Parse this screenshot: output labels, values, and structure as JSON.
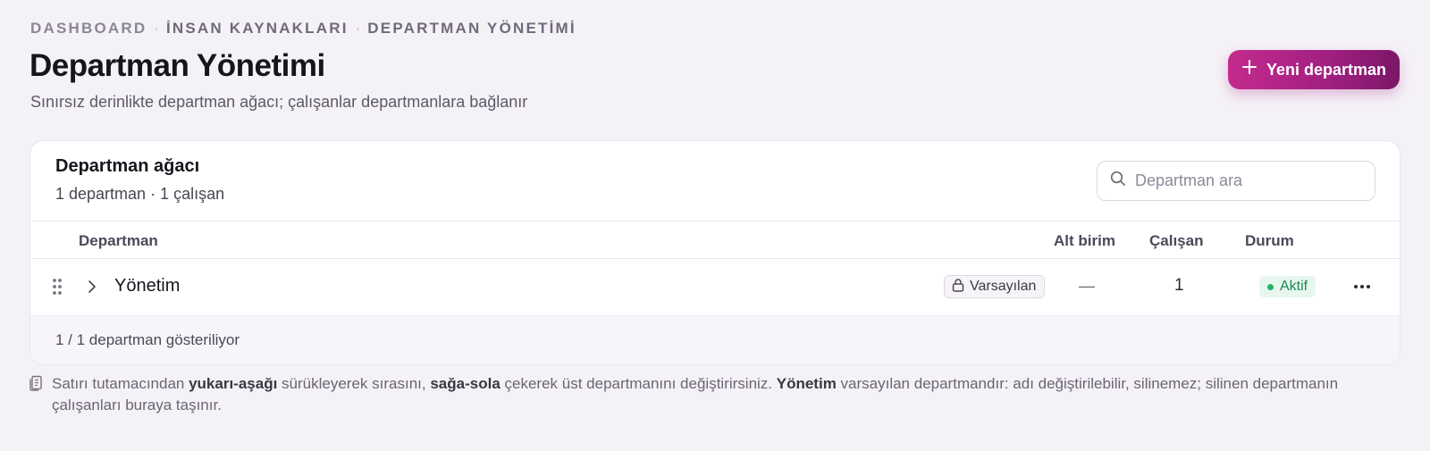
{
  "breadcrumb": {
    "items": [
      "DASHBOARD",
      "İNSAN KAYNAKLARI",
      "DEPARTMAN YÖNETİMİ"
    ],
    "separator": "·"
  },
  "page": {
    "title": "Departman Yönetimi",
    "subtitle": "Sınırsız derinlikte departman ağacı; çalışanlar departmanlara bağlanır",
    "new_button_label": "Yeni departman",
    "new_button_icon": "plus-icon"
  },
  "card": {
    "title": "Departman ağacı",
    "meta": "1 departman · 1 çalışan",
    "search_placeholder": "Departman ara",
    "search_value": "",
    "columns": {
      "department": "Departman",
      "sub_units": "Alt birim",
      "employees": "Çalışan",
      "status": "Durum"
    },
    "rows": [
      {
        "name": "Yönetim",
        "tag": "Varsayılan",
        "sub_units": "—",
        "employees": "1",
        "status": "Aktif"
      }
    ],
    "footer": "1 / 1 departman gösteriliyor"
  },
  "help": {
    "t1": "Satırı tutamacından ",
    "b1": "yukarı-aşağı",
    "t2": " sürükleyerek sırasını, ",
    "b2": "sağa-sola",
    "t3": " çekerek üst departmanını değiştirirsiniz. ",
    "b3": "Yönetim",
    "t4": " varsayılan departmandır: adı değiştirilebilir, silinemez; silinen departmanın çalışanları buraya taşınır."
  },
  "colors": {
    "accent": "#a01f80",
    "accent_light": "#c42a8e",
    "status_active": "#22b469",
    "background": "#f5f2f7"
  }
}
